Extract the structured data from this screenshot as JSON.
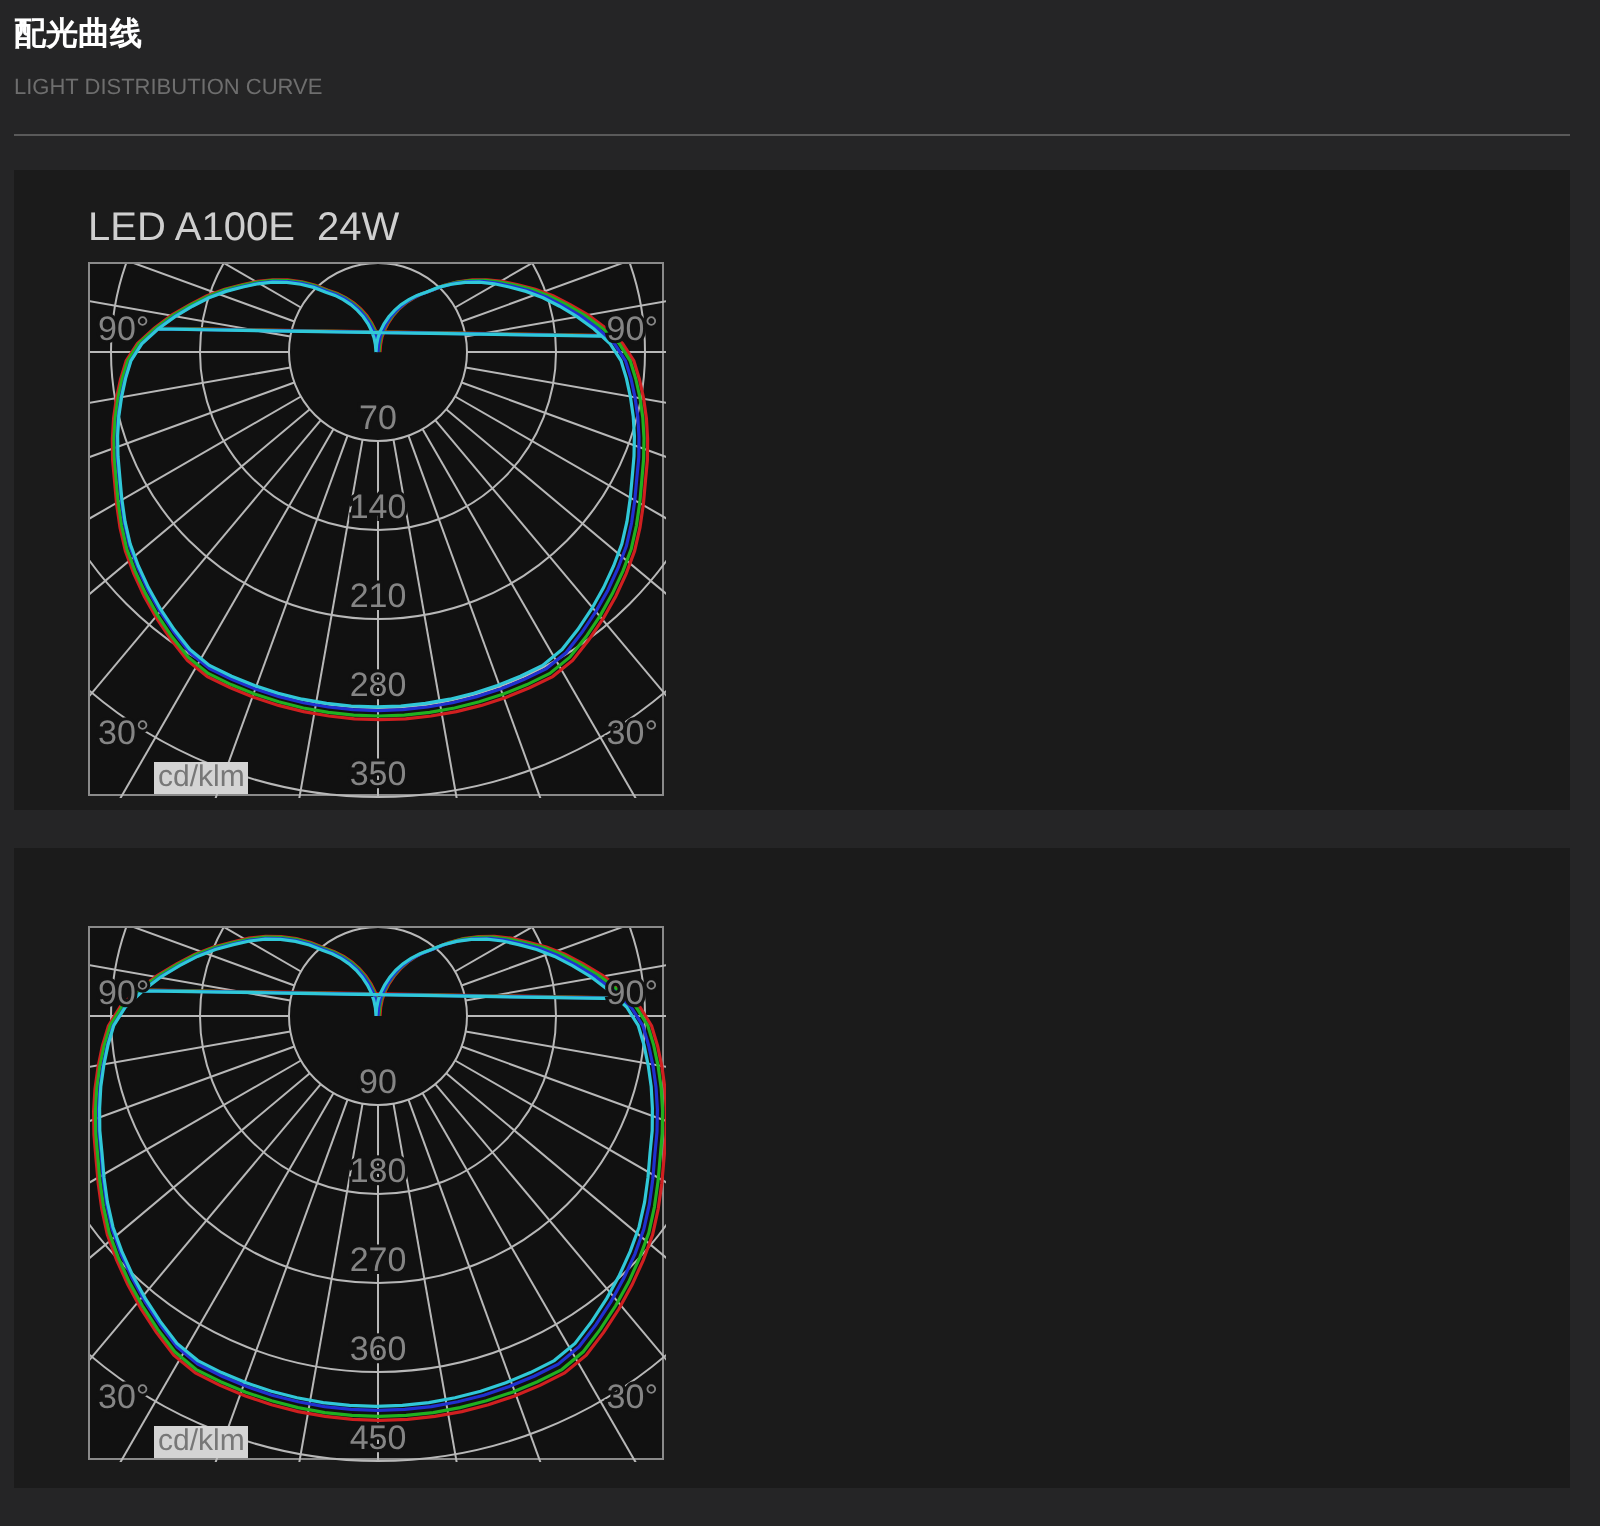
{
  "header": {
    "title": "配光曲线",
    "subtitle": "LIGHT DISTRIBUTION CURVE"
  },
  "panels": [
    {
      "title": "LED A100E  24W",
      "diagram": {
        "angle_labels": [
          "90°",
          "90°",
          "30°",
          "30°"
        ],
        "ring_labels": [
          "70",
          "140",
          "210",
          "280",
          "350"
        ],
        "unit": "cd/klm"
      }
    },
    {
      "diagram": {
        "angle_labels": [
          "90°",
          "90°",
          "30°",
          "30°"
        ],
        "ring_labels": [
          "90",
          "180",
          "270",
          "360",
          "450"
        ],
        "unit": "cd/klm"
      }
    }
  ]
}
